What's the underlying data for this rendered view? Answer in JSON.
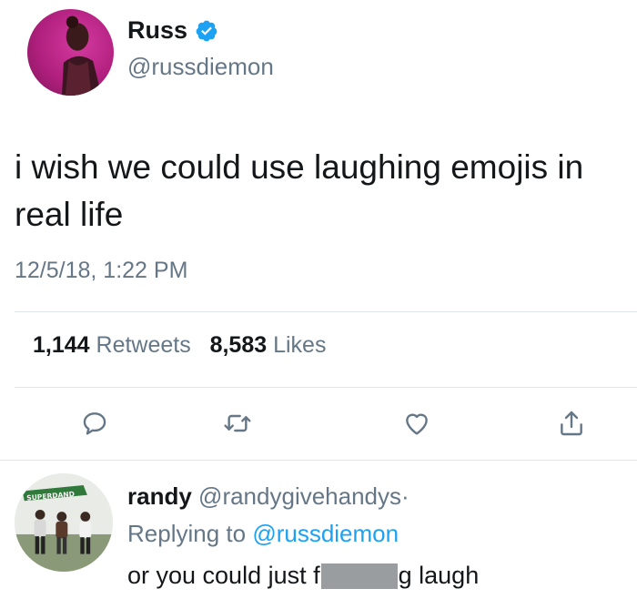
{
  "tweet": {
    "author_name": "Russ",
    "author_handle": "@russdiemon",
    "verified": true,
    "text": "i wish we could use laughing emojis in real life",
    "timestamp": "12/5/18, 1:22 PM",
    "retweets_count": "1,144",
    "retweets_label": "Retweets",
    "likes_count": "8,583",
    "likes_label": "Likes"
  },
  "actions": {
    "reply_icon": "reply-icon",
    "retweet_icon": "retweet-icon",
    "like_icon": "heart-icon",
    "share_icon": "share-icon"
  },
  "reply": {
    "name": "randy",
    "handle": "@randygivehandys",
    "separator": "·",
    "replying_prefix": "Replying to",
    "replying_to": "@russdiemon",
    "text_before": "or you could just f",
    "text_after": "g laugh",
    "avatar_lettering": "SUPERDAND"
  },
  "colors": {
    "accent": "#1da1f2",
    "secondary_text": "#657786",
    "primary_text": "#14171a",
    "avatar_bg": "#c0278a"
  }
}
